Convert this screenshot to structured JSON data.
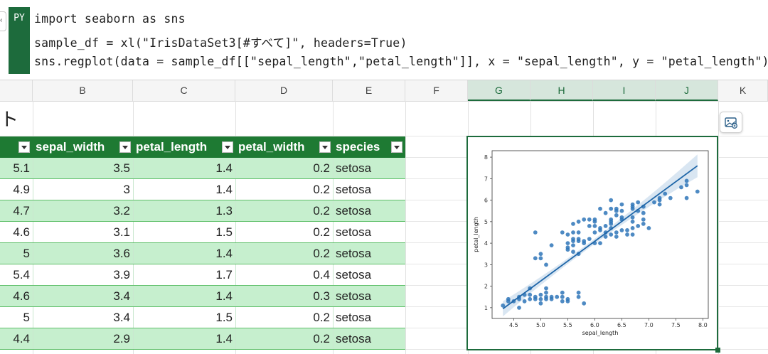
{
  "formula": {
    "badge": "PY",
    "lines": [
      "import seaborn as sns",
      "sample_df = xl(\"IrisDataSet3[#すべて]\", headers=True)",
      "sns.regplot(data = sample_df[[\"sepal_length\",\"petal_length\"]], x = \"sepal_length\", y = \"petal_length\")"
    ]
  },
  "columns": [
    "B",
    "C",
    "D",
    "E",
    "F",
    "G",
    "H",
    "I",
    "J",
    "K"
  ],
  "sheet_title_fragment": "ト",
  "table": {
    "headers": [
      "sepal_width",
      "petal_length",
      "petal_width",
      "species"
    ],
    "rows": [
      [
        "5.1",
        "3.5",
        "1.4",
        "0.2",
        "setosa"
      ],
      [
        "4.9",
        "3",
        "1.4",
        "0.2",
        "setosa"
      ],
      [
        "4.7",
        "3.2",
        "1.3",
        "0.2",
        "setosa"
      ],
      [
        "4.6",
        "3.1",
        "1.5",
        "0.2",
        "setosa"
      ],
      [
        "5",
        "3.6",
        "1.4",
        "0.2",
        "setosa"
      ],
      [
        "5.4",
        "3.9",
        "1.7",
        "0.4",
        "setosa"
      ],
      [
        "4.6",
        "3.4",
        "1.4",
        "0.3",
        "setosa"
      ],
      [
        "5",
        "3.4",
        "1.5",
        "0.2",
        "setosa"
      ],
      [
        "4.4",
        "2.9",
        "1.4",
        "0.2",
        "setosa"
      ]
    ]
  },
  "colors": {
    "header_green": "#1e7a33",
    "band_green": "#c6efce",
    "accent": "#1d6b3c",
    "point": "#2f76b8"
  },
  "chart_data": {
    "type": "scatter",
    "xlabel": "sepal_length",
    "ylabel": "petal_length",
    "xlim": [
      4.1,
      8.1
    ],
    "ylim": [
      0.5,
      8.3
    ],
    "xticks": [
      "4.5",
      "5.0",
      "5.5",
      "6.0",
      "6.5",
      "7.0",
      "7.5",
      "8.0"
    ],
    "yticks": [
      "1",
      "2",
      "3",
      "4",
      "5",
      "6",
      "7",
      "8"
    ],
    "regression": {
      "x": [
        4.3,
        7.9
      ],
      "y": [
        0.95,
        7.6
      ]
    },
    "points": [
      [
        4.3,
        1.1
      ],
      [
        4.4,
        1.3
      ],
      [
        4.4,
        1.4
      ],
      [
        4.5,
        1.3
      ],
      [
        4.6,
        1.0
      ],
      [
        4.6,
        1.4
      ],
      [
        4.6,
        1.5
      ],
      [
        4.7,
        1.3
      ],
      [
        4.7,
        1.6
      ],
      [
        4.8,
        1.4
      ],
      [
        4.8,
        1.6
      ],
      [
        4.8,
        1.9
      ],
      [
        4.9,
        1.4
      ],
      [
        4.9,
        1.5
      ],
      [
        4.9,
        3.3
      ],
      [
        4.9,
        4.5
      ],
      [
        5.0,
        1.2
      ],
      [
        5.0,
        1.4
      ],
      [
        5.0,
        1.6
      ],
      [
        5.0,
        3.3
      ],
      [
        5.0,
        3.5
      ],
      [
        5.1,
        1.4
      ],
      [
        5.1,
        1.5
      ],
      [
        5.1,
        1.7
      ],
      [
        5.1,
        1.9
      ],
      [
        5.1,
        3.0
      ],
      [
        5.2,
        1.4
      ],
      [
        5.2,
        1.5
      ],
      [
        5.2,
        3.9
      ],
      [
        5.3,
        1.5
      ],
      [
        5.4,
        1.3
      ],
      [
        5.4,
        1.5
      ],
      [
        5.4,
        1.7
      ],
      [
        5.4,
        4.5
      ],
      [
        5.5,
        1.3
      ],
      [
        5.5,
        1.4
      ],
      [
        5.5,
        3.7
      ],
      [
        5.5,
        3.8
      ],
      [
        5.5,
        4.0
      ],
      [
        5.5,
        4.4
      ],
      [
        5.6,
        3.6
      ],
      [
        5.6,
        3.9
      ],
      [
        5.6,
        4.1
      ],
      [
        5.6,
        4.2
      ],
      [
        5.6,
        4.5
      ],
      [
        5.6,
        4.9
      ],
      [
        5.7,
        1.5
      ],
      [
        5.7,
        1.7
      ],
      [
        5.7,
        3.5
      ],
      [
        5.7,
        4.1
      ],
      [
        5.7,
        4.2
      ],
      [
        5.7,
        4.5
      ],
      [
        5.7,
        5.0
      ],
      [
        5.8,
        1.2
      ],
      [
        5.8,
        4.0
      ],
      [
        5.8,
        4.1
      ],
      [
        5.8,
        5.1
      ],
      [
        5.9,
        4.2
      ],
      [
        5.9,
        4.8
      ],
      [
        5.9,
        5.1
      ],
      [
        6.0,
        4.0
      ],
      [
        6.0,
        4.5
      ],
      [
        6.0,
        4.8
      ],
      [
        6.0,
        5.0
      ],
      [
        6.0,
        5.1
      ],
      [
        6.1,
        4.0
      ],
      [
        6.1,
        4.6
      ],
      [
        6.1,
        4.7
      ],
      [
        6.1,
        5.6
      ],
      [
        6.2,
        4.3
      ],
      [
        6.2,
        4.5
      ],
      [
        6.2,
        4.8
      ],
      [
        6.2,
        5.4
      ],
      [
        6.3,
        4.4
      ],
      [
        6.3,
        4.7
      ],
      [
        6.3,
        4.9
      ],
      [
        6.3,
        5.0
      ],
      [
        6.3,
        5.1
      ],
      [
        6.3,
        5.6
      ],
      [
        6.3,
        6.0
      ],
      [
        6.4,
        4.3
      ],
      [
        6.4,
        4.5
      ],
      [
        6.4,
        5.3
      ],
      [
        6.4,
        5.5
      ],
      [
        6.4,
        5.6
      ],
      [
        6.5,
        4.6
      ],
      [
        6.5,
        5.1
      ],
      [
        6.5,
        5.2
      ],
      [
        6.5,
        5.5
      ],
      [
        6.5,
        5.8
      ],
      [
        6.6,
        4.4
      ],
      [
        6.6,
        4.6
      ],
      [
        6.7,
        4.4
      ],
      [
        6.7,
        4.7
      ],
      [
        6.7,
        5.0
      ],
      [
        6.7,
        5.2
      ],
      [
        6.7,
        5.6
      ],
      [
        6.7,
        5.7
      ],
      [
        6.7,
        5.8
      ],
      [
        6.8,
        4.8
      ],
      [
        6.8,
        5.5
      ],
      [
        6.8,
        5.9
      ],
      [
        6.9,
        4.9
      ],
      [
        6.9,
        5.1
      ],
      [
        6.9,
        5.4
      ],
      [
        6.9,
        5.7
      ],
      [
        7.0,
        4.7
      ],
      [
        7.1,
        5.9
      ],
      [
        7.2,
        5.8
      ],
      [
        7.2,
        6.0
      ],
      [
        7.2,
        6.1
      ],
      [
        7.3,
        6.3
      ],
      [
        7.4,
        6.1
      ],
      [
        7.6,
        6.6
      ],
      [
        7.7,
        6.1
      ],
      [
        7.7,
        6.7
      ],
      [
        7.7,
        6.9
      ],
      [
        7.9,
        6.4
      ]
    ]
  }
}
